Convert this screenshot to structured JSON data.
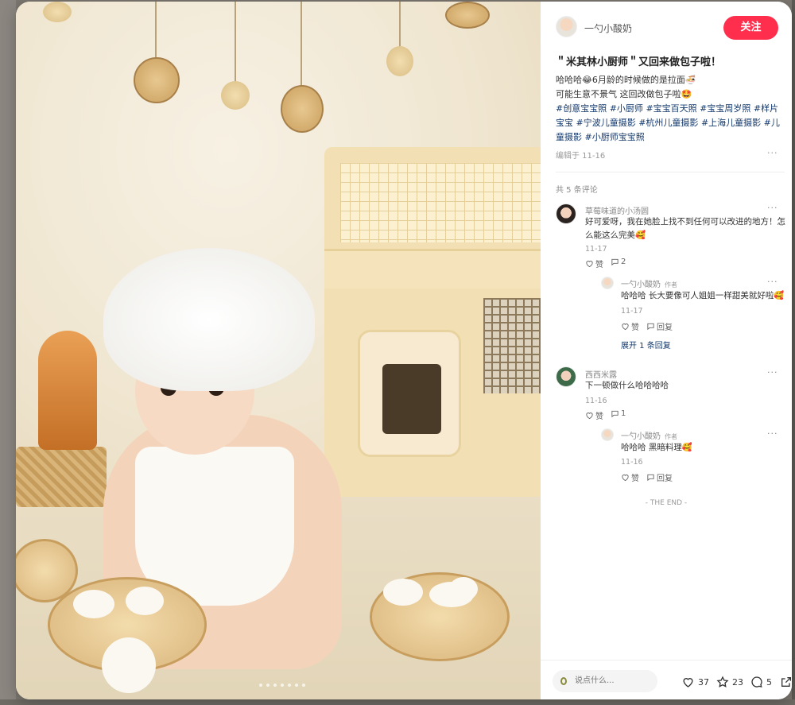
{
  "author": {
    "name": "一勺小酸奶",
    "follow_label": "关注"
  },
  "note": {
    "title": "＂米其林小厨师＂又回来做包子啦！",
    "body_line1": "哈哈哈😂6月龄的时候做的是拉面🍜",
    "body_line2": "可能生意不景气 这回改做包子啦🤩",
    "tags": [
      "#创意宝宝照",
      "#小厨师",
      "#宝宝百天照",
      "#宝宝周岁照",
      "#样片宝宝",
      "#宁波儿童摄影",
      "#杭州儿童摄影",
      "#上海儿童摄影",
      "#儿童摄影",
      "#小厨师宝宝照"
    ],
    "edited": "编辑于 11-16"
  },
  "comments_count": "共 5 条评论",
  "comments": [
    {
      "name": "草莓味道的小汤圆",
      "text_line1": "好可爱呀，我在她脸上找不到任何可以改进的地方！怎",
      "text_line2": "么能这么完美🥰",
      "date": "11-17",
      "like": "赞",
      "replies": "2",
      "reply": {
        "name": "一勺小酸奶",
        "author_tag": "作者",
        "text": "哈哈哈 长大要像可人姐姐一样甜美就好啦🥰",
        "date": "11-17",
        "like": "赞",
        "reply_label": "回复"
      },
      "expand": "展开 1 条回复"
    },
    {
      "name": "西西米露",
      "text_line1": "下一顿做什么哈哈哈哈",
      "date": "11-16",
      "like": "赞",
      "replies": "1",
      "reply": {
        "name": "一勺小酸奶",
        "author_tag": "作者",
        "text": "哈哈哈 黑暗料理🥰",
        "date": "11-16",
        "like": "赞",
        "reply_label": "回复"
      }
    }
  ],
  "end_text": "- THE END -",
  "bottom": {
    "placeholder": "说点什么...",
    "likes": "37",
    "stars": "23",
    "comments": "5"
  },
  "icons": [
    "heart-icon",
    "chat-icon",
    "star-icon",
    "share-icon",
    "pencil-icon",
    "more-icon"
  ],
  "colors": {
    "follow": "#ff2e4d",
    "tag": "#13386c"
  }
}
